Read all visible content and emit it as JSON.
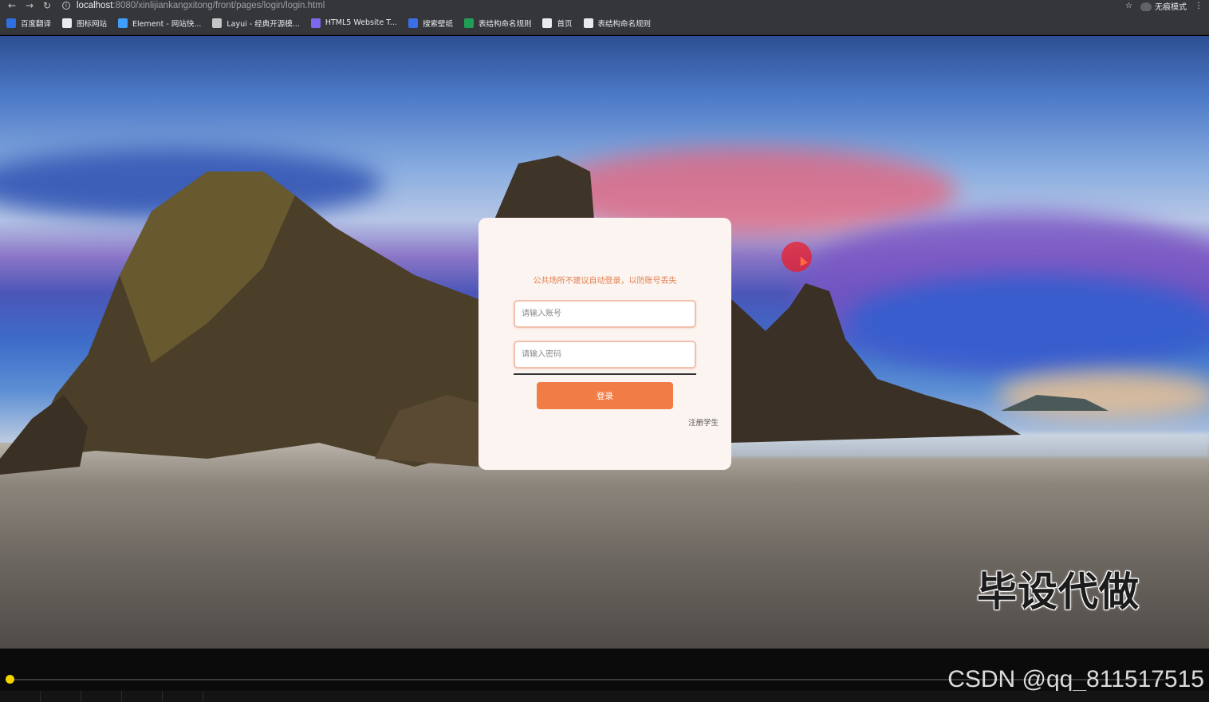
{
  "browser": {
    "url_host": "localhost",
    "url_path": ":8080/xinlijiankangxitong/front/pages/login/login.html",
    "incognito_label": "无痕模式",
    "bookmarks": [
      {
        "label": "百度翻译",
        "icon": "baidu-translate-icon",
        "color": "#2f6fe0"
      },
      {
        "label": "图标网站",
        "icon": "flag-icon",
        "color": "#e8eaed"
      },
      {
        "label": "Element - 网站快...",
        "icon": "element-icon",
        "color": "#409eff"
      },
      {
        "label": "Layui - 经典开源模...",
        "icon": "layui-icon",
        "color": "#c4c7c5"
      },
      {
        "label": "HTML5 Website T...",
        "icon": "html5-template-icon",
        "color": "#7b68ee"
      },
      {
        "label": "搜索壁纸",
        "icon": "wallpaper-icon",
        "color": "#3b6fe8"
      },
      {
        "label": "表结构命名规则",
        "icon": "doc-icon",
        "color": "#1f9d55"
      },
      {
        "label": "首页",
        "icon": "globe-icon",
        "color": "#e8eaed"
      },
      {
        "label": "表结构命名规则",
        "icon": "globe-icon",
        "color": "#e8eaed"
      }
    ]
  },
  "login": {
    "tip": "公共场所不建议自动登录，以防账号丢失",
    "account_placeholder": "请输入账号",
    "password_placeholder": "请输入密码",
    "login_button": "登录",
    "register_link": "注册学生"
  },
  "overlay": {
    "watermark_text": "毕设代做",
    "csdn_text": "CSDN @qq_811517515"
  },
  "player": {
    "progress": 0.005,
    "accent": "#f5d400"
  },
  "colors": {
    "accent": "#f27c46",
    "tip": "#e5804f"
  }
}
